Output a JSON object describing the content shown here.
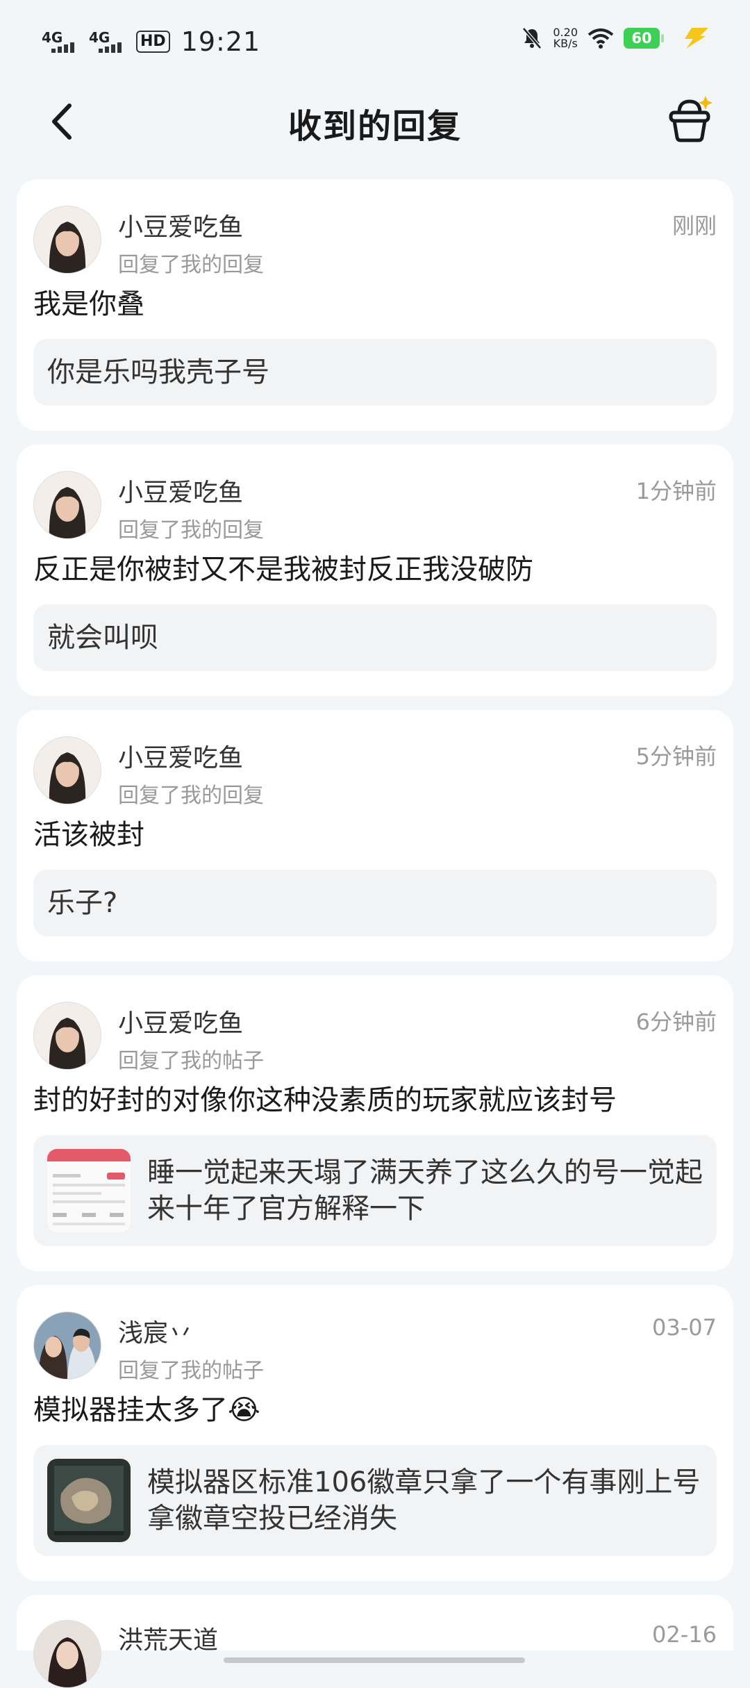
{
  "status_bar": {
    "signal1": "4G",
    "signal2": "4G",
    "hd": "HD",
    "time": "19:21",
    "net_speed_value": "0.20",
    "net_speed_unit": "KB/s",
    "battery": "60"
  },
  "header": {
    "title": "收到的回复"
  },
  "replies": [
    {
      "user": "小豆爱吃鱼",
      "action": "回复了我的回复",
      "time": "刚刚",
      "content": "我是你叠",
      "quote": "你是乐吗我壳子号"
    },
    {
      "user": "小豆爱吃鱼",
      "action": "回复了我的回复",
      "time": "1分钟前",
      "content": "反正是你被封又不是我被封反正我没破防",
      "quote": "就会叫呗"
    },
    {
      "user": "小豆爱吃鱼",
      "action": "回复了我的回复",
      "time": "5分钟前",
      "content": "活该被封",
      "quote": "乐子?"
    },
    {
      "user": "小豆爱吃鱼",
      "action": "回复了我的帖子",
      "time": "6分钟前",
      "content": "封的好封的对像你这种没素质的玩家就应该封号",
      "quote": "睡一觉起来天塌了满天养了这么久的号一觉起来十年了官方解释一下"
    },
    {
      "user": "浅宸丷",
      "action": "回复了我的帖子",
      "time": "03-07",
      "content": "模拟器挂太多了",
      "emoji": "😭",
      "quote": "模拟器区标准106徽章只拿了一个有事刚上号拿徽章空投已经消失"
    },
    {
      "user": "洪荒天道",
      "time": "02-16"
    }
  ]
}
